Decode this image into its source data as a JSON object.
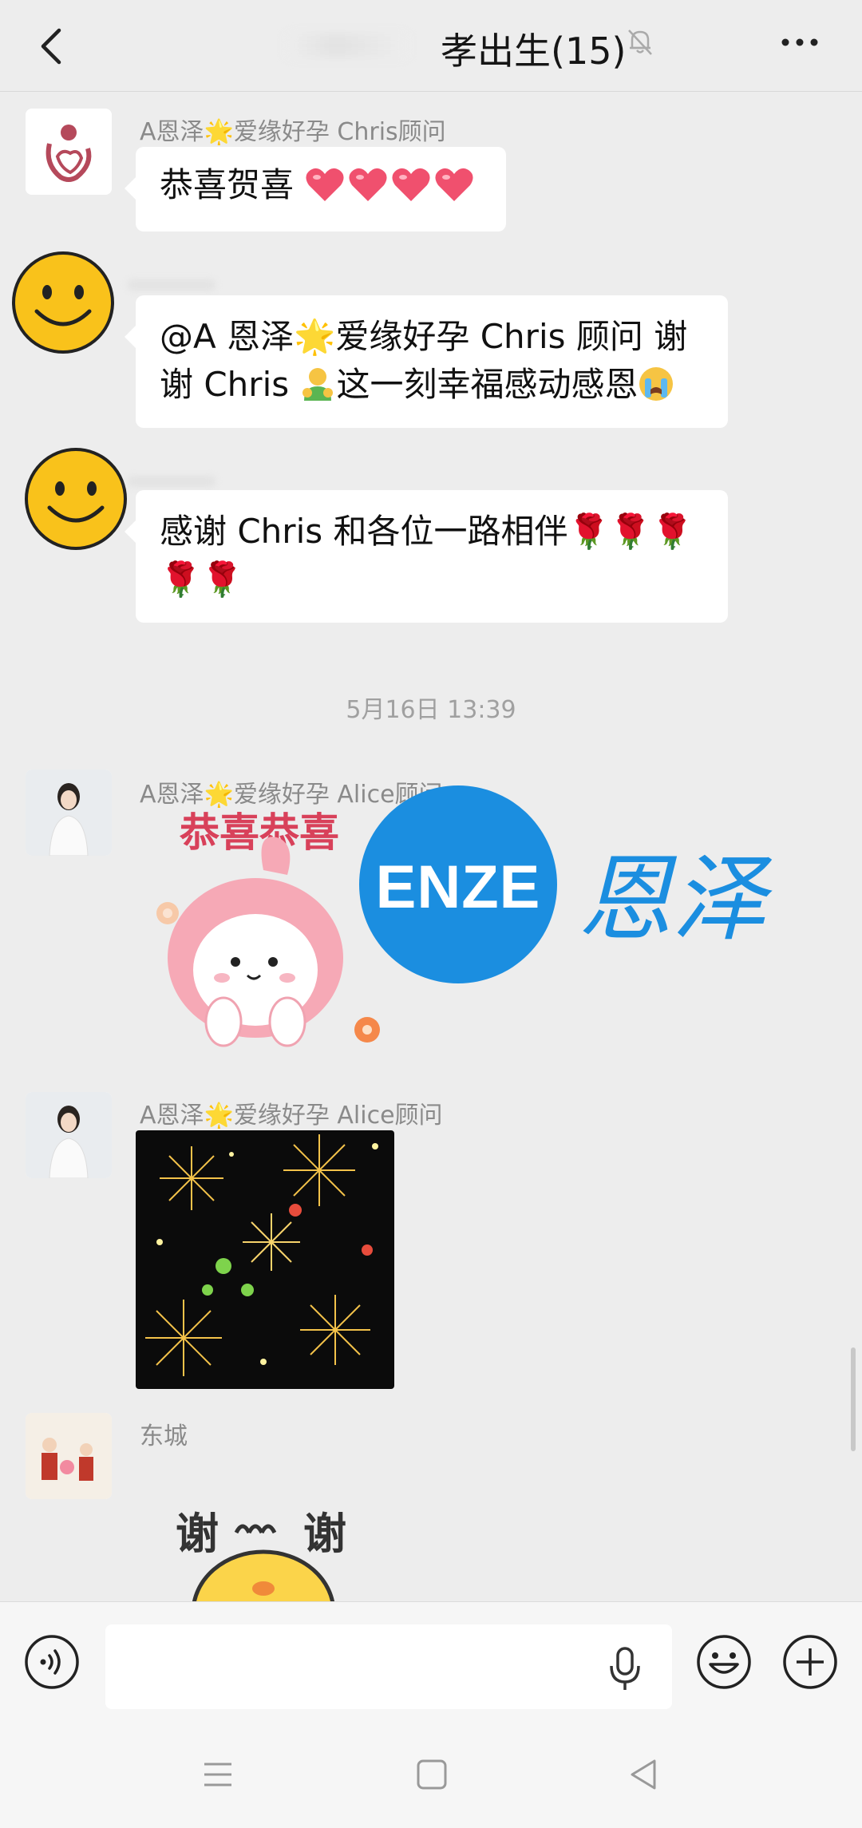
{
  "header": {
    "title": "孝出生(15)",
    "back_icon": "chevron-left-icon",
    "mute_icon": "bell-muted-icon",
    "more_icon": "more-dots-icon"
  },
  "messages": [
    {
      "sender": "A恩泽🌟爱缘好孕 Chris顾问",
      "text": "恭喜贺喜"
    },
    {
      "line1": "@A 恩泽🌟爱缘好孕 Chris 顾问  谢",
      "line2a": "谢 Chris ",
      "line2b": "这一刻幸福感动感恩"
    },
    {
      "line1": "感谢 Chris 和各位一路相伴🌹🌹🌹",
      "line2": "🌹🌹"
    },
    {
      "timestamp": "5月16日 13:39"
    },
    {
      "sender": "A恩泽🌟爱缘好孕 Alice顾问",
      "sticker_text": "恭喜恭喜"
    },
    {
      "sender": "A恩泽🌟爱缘好孕 Alice顾问"
    },
    {
      "sender": "东城",
      "sticker_text_left": "谢",
      "sticker_text_right": "谢"
    }
  ],
  "watermark": {
    "logo_text": "ENZE",
    "logo_cn": "恩泽",
    "color": "#1b8ee0"
  },
  "inputbar": {
    "voice_icon": "voice-toggle-icon",
    "mic_icon": "microphone-icon",
    "emoji_icon": "emoji-icon",
    "plus_icon": "plus-icon"
  },
  "navbar": {
    "menu_icon": "menu-icon",
    "home_icon": "home-square-icon",
    "back_icon": "back-triangle-icon"
  }
}
